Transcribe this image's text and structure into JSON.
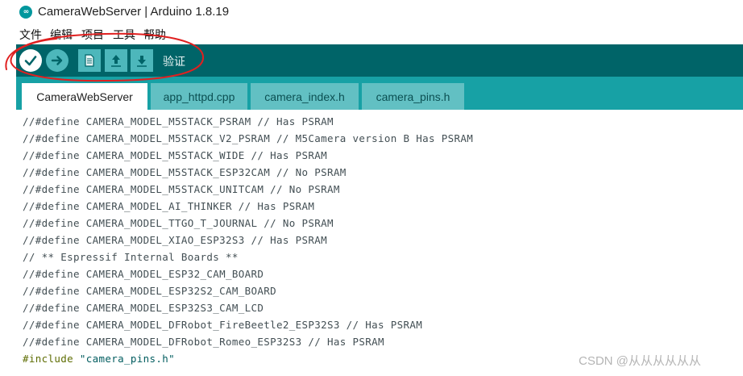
{
  "window": {
    "title": "CameraWebServer | Arduino 1.8.19",
    "icon": "arduino-logo-icon"
  },
  "menu": {
    "items": [
      "文件",
      "编辑",
      "项目",
      "工具",
      "帮助"
    ]
  },
  "toolbar": {
    "hover_label": "验证",
    "buttons": [
      "verify-icon",
      "upload-icon",
      "new-icon",
      "open-icon",
      "save-icon"
    ]
  },
  "tabs": [
    "CameraWebServer",
    "app_httpd.cpp",
    "camera_index.h",
    "camera_pins.h"
  ],
  "code": {
    "lines": [
      "//#define CAMERA_MODEL_M5STACK_PSRAM // Has PSRAM",
      "//#define CAMERA_MODEL_M5STACK_V2_PSRAM // M5Camera version B Has PSRAM",
      "//#define CAMERA_MODEL_M5STACK_WIDE // Has PSRAM",
      "//#define CAMERA_MODEL_M5STACK_ESP32CAM // No PSRAM",
      "//#define CAMERA_MODEL_M5STACK_UNITCAM // No PSRAM",
      "//#define CAMERA_MODEL_AI_THINKER // Has PSRAM",
      "//#define CAMERA_MODEL_TTGO_T_JOURNAL // No PSRAM",
      "//#define CAMERA_MODEL_XIAO_ESP32S3 // Has PSRAM",
      "// ** Espressif Internal Boards **",
      "//#define CAMERA_MODEL_ESP32_CAM_BOARD",
      "//#define CAMERA_MODEL_ESP32S2_CAM_BOARD",
      "//#define CAMERA_MODEL_ESP32S3_CAM_LCD",
      "//#define CAMERA_MODEL_DFRobot_FireBeetle2_ESP32S3 // Has PSRAM",
      "//#define CAMERA_MODEL_DFRobot_Romeo_ESP32S3 // Has PSRAM"
    ],
    "include_keyword": "#include",
    "include_file": "\"camera_pins.h\""
  },
  "watermark": "CSDN @从从从从从从",
  "colors": {
    "toolbar": "#006468",
    "tabbar": "#17a1a5",
    "annotation": "#e02020"
  }
}
